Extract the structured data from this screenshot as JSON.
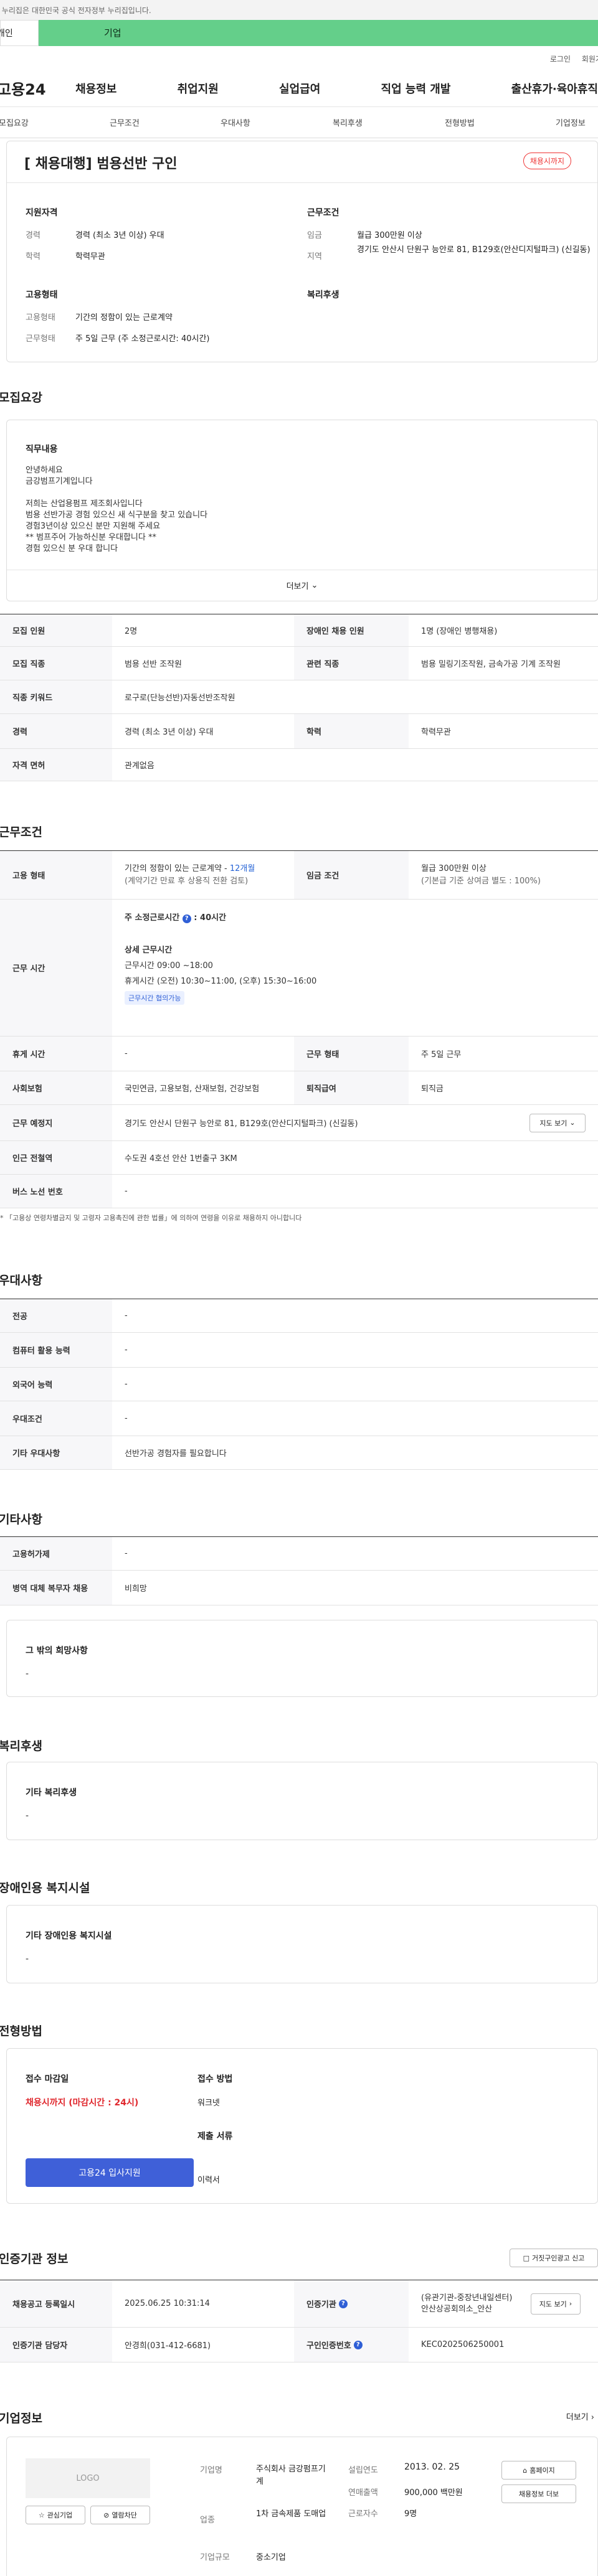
{
  "gov_notice": "이 누리집은 대한민국 공식 전자정부 누리집입니다.",
  "tabs": {
    "personal": "개인",
    "business": "기업"
  },
  "util": {
    "login": "로그인",
    "signup": "회원가입"
  },
  "brand": "고용24",
  "gnb": [
    "채용정보",
    "취업지원",
    "실업급여",
    "직업 능력 개발",
    "출산휴가·육아휴직"
  ],
  "anchor_tabs": [
    "모집요강",
    "근무조건",
    "우대사항",
    "복리후생",
    "전형방법",
    "기업정보"
  ],
  "summary": {
    "title": "[ 채용대행] 범용선반 구인",
    "badge": "채용시까지",
    "qual_heading": "지원자격",
    "career_label": "경력",
    "career_value": "경력 (최소 3년 이상) 우대",
    "edu_label": "학력",
    "edu_value": "학력무관",
    "work_heading": "근무조건",
    "wage_label": "임금",
    "wage_value": "월급 300만원 이상",
    "area_label": "지역",
    "area_value": "경기도 안산시 단원구 능안로 81, B129호(안산디지털파크) (신길동)",
    "emp_heading": "고용형태",
    "emptype_label": "고용형태",
    "emptype_value": "기간의 정함이 있는 근로계약",
    "hours_label": "근무형태",
    "hours_value": "주 5일 근무 (주 소정근로시간: 40시간)",
    "welfare_heading": "복리후생"
  },
  "recruit": {
    "heading": "모집요강",
    "duty_title": "직무내용",
    "duty_lines": [
      "안녕하세요",
      "금강범프기계입니다",
      "",
      "저희는 산업용펌프 제조회사입니다",
      "범용 선반가공 경험 있으신 새 식구분을 찾고 있습니다",
      "경험3년이상  있으신 분만 지원해 주세요",
      "** 범프주어 가능하신분 우대합니다 **",
      "경험 있으신 분 우대 합니다"
    ],
    "more": "더보기",
    "rows": [
      [
        "모집 인원",
        "2명",
        "장애인 채용 인원",
        "1명 (장애인 병행채용)"
      ],
      [
        "모집 직종",
        "범용 선반 조작원",
        "관련 직종",
        "범용 밀링기조작원, 금속가공 기계 조작원"
      ],
      [
        "직종 키워드",
        "로구로(단능선반)자동선반조작원",
        "",
        ""
      ],
      [
        "경력",
        "경력 (최소 3년 이상) 우대",
        "학력",
        "학력무관"
      ],
      [
        "자격 면허",
        "관계없음",
        "",
        ""
      ]
    ]
  },
  "conditions": {
    "heading": "근무조건",
    "emp_type_label": "고용 형태",
    "emp_type_value": "기간의 정함이 있는 근로계약",
    "emp_type_months": "12개월",
    "emp_type_sub": "(계약기간 만료 후 상용직 전환 검토)",
    "wage_label": "임금 조건",
    "wage_value": "월급 300만원 이상",
    "wage_sub": "(기본급 기준 상여금 별도 : 100%)",
    "hours_label": "근무 시간",
    "weekly_label": "주 소정근로시간",
    "weekly_value": "40시간",
    "detail_title": "상세 근무시간",
    "detail_1": "근무시간 09:00 ~18:00",
    "detail_2": "휴게시간 (오전) 10:30~11:00,  (오후) 15:30~16:00",
    "flex_badge": "근무시간 협의가능",
    "break_label": "휴게 시간",
    "break_value": "-",
    "form_label": "근무 형태",
    "form_value": "주 5일 근무",
    "ins_label": "사회보험",
    "ins_value": "국민연금, 고용보험, 산재보험, 건강보험",
    "retire_label": "퇴직급여",
    "retire_value": "퇴직금",
    "place_label": "근무 예정지",
    "place_value": "경기도 안산시 단원구 능안로 81, B129호(안산디지털파크) (신길동)",
    "map_button": "지도 보기",
    "station_label": "인근 전철역",
    "station_value": "수도권 4호선 안산 1번출구 3KM",
    "bus_label": "버스 노선 번호",
    "bus_value": "-",
    "note": "* 「고용상 연령차별금지 및 고령자 고용촉진에 관한 법률」에 의하여 연령을 이유로 채용하지 아니합니다"
  },
  "preference": {
    "heading": "우대사항",
    "rows": [
      [
        "전공",
        "-"
      ],
      [
        "컴퓨터 활용 능력",
        "-"
      ],
      [
        "외국어 능력",
        "-"
      ],
      [
        "우대조건",
        "-"
      ],
      [
        "기타 우대사항",
        "선반가공 경험자를 필요합니다"
      ]
    ]
  },
  "etc": {
    "heading": "기타사항",
    "rows": [
      [
        "고용허가제",
        "-"
      ],
      [
        "병역 대체 복무자 채용",
        "비희망"
      ]
    ],
    "box_title": "그 밖의 희망사항",
    "box_value": "-"
  },
  "welfare": {
    "heading": "복리후생",
    "box_title": "기타 복리후생",
    "box_value": "-"
  },
  "disabled": {
    "heading": "장애인용 복지시설",
    "box_title": "기타 장애인용 복지시설",
    "box_value": "-"
  },
  "selection": {
    "heading": "전형방법",
    "deadline_label": "접수 마감일",
    "deadline_value": "채용시까지 (마감시간 : 24시)",
    "apply_button": "고용24 입사지원",
    "method_label": "접수 방법",
    "method_value": "워크넷",
    "docs_label": "제출 서류",
    "docs_value": "이력서"
  },
  "agency": {
    "heading": "인증기관 정보",
    "report_button": "거짓구인광고 신고",
    "reg_label": "채용공고 등록일시",
    "reg_value": "2025.06.25 10:31:14",
    "org_label": "인증기관",
    "org_value": "(유관기관-중장년내일센터)\n안산상공회의소_안산",
    "map_button": "지도 보기",
    "manager_label": "인증기관 담당자",
    "manager_value": "안경희(031-412-6681)",
    "reqno_label": "구인인증번호",
    "reqno_value": "KEC0202506250001"
  },
  "company": {
    "heading": "기업정보",
    "more": "더보기",
    "logo_text": "LOGO",
    "interest_button": "관심기업",
    "block_button": "열람차단",
    "name_label": "기업명",
    "name_value": "주식회사 금강펌프기계",
    "industry_label": "업종",
    "industry_value": "1차 금속제품 도매업",
    "scale_label": "기업규모",
    "scale_value": "중소기업",
    "founded_label": "설립연도",
    "founded_value": "2013. 02. 25",
    "sales_label": "연매출액",
    "sales_value": "900,000 백만원",
    "employees_label": "근로자수",
    "employees_value": "9명",
    "homepage_button": "홈페이지",
    "jobs_button": "채용정보 더보"
  }
}
